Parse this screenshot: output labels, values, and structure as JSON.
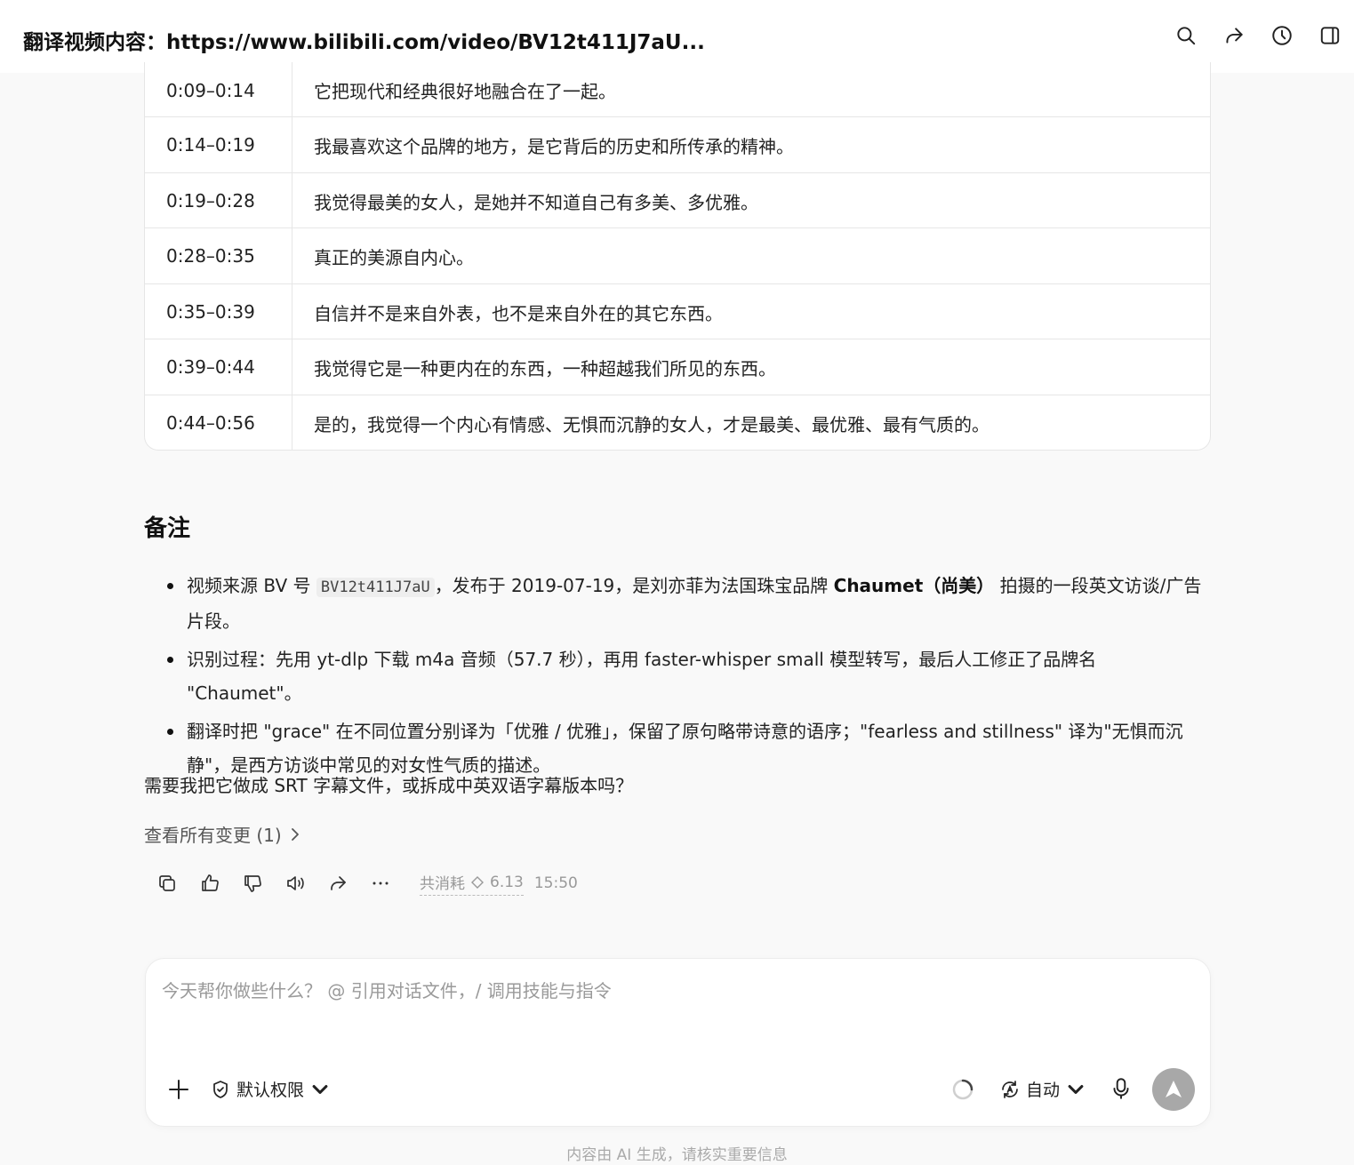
{
  "header": {
    "title": "翻译视频内容：https://www.bilibili.com/video/BV12t411J7aU...",
    "icons": [
      "search-icon",
      "share-icon",
      "history-icon",
      "sidebar-icon"
    ]
  },
  "table": {
    "rows": [
      {
        "time": "0:09–0:14",
        "text": "它把现代和经典很好地融合在了一起。"
      },
      {
        "time": "0:14–0:19",
        "text": "我最喜欢这个品牌的地方，是它背后的历史和所传承的精神。"
      },
      {
        "time": "0:19–0:28",
        "text": "我觉得最美的女人，是她并不知道自己有多美、多优雅。"
      },
      {
        "time": "0:28–0:35",
        "text": "真正的美源自内心。"
      },
      {
        "time": "0:35–0:39",
        "text": "自信并不是来自外表，也不是来自外在的其它东西。"
      },
      {
        "time": "0:39–0:44",
        "text": "我觉得它是一种更内在的东西，一种超越我们所见的东西。"
      },
      {
        "time": "0:44–0:56",
        "text": "是的，我觉得一个内心有情感、无惧而沉静的女人，才是最美、最优雅、最有气质的。"
      }
    ]
  },
  "notes": {
    "heading": "备注",
    "item1": {
      "pre": "视频来源 BV 号 ",
      "code": "BV12t411J7aU",
      "mid": "，发布于 2019-07-19，是刘亦菲为法国珠宝品牌 ",
      "brand": "Chaumet（尚美）",
      "post": " 拍摄的一段英文访谈/广告片段。"
    },
    "item2": "识别过程：先用 yt-dlp 下载 m4a 音频（57.7 秒），再用 faster-whisper small 模型转写，最后人工修正了品牌名 \"Chaumet\"。",
    "item3": "翻译时把 \"grace\" 在不同位置分别译为「优雅 / 优雅」，保留了原句略带诗意的语序；\"fearless and stillness\" 译为\"无惧而沉静\"，是西方访谈中常见的对女性气质的描述。"
  },
  "question": "需要我把它做成 SRT 字幕文件，或拆成中英双语字幕版本吗？",
  "changes_link": "查看所有变更 (1)",
  "actions": {
    "icons": [
      "copy-icon",
      "thumbs-up-icon",
      "thumbs-down-icon",
      "speaker-icon",
      "share-icon",
      "more-icon"
    ],
    "usage_label": "共消耗",
    "usage_value": "6.13",
    "time": "15:50"
  },
  "composer": {
    "placeholder": "今天帮你做些什么？ @ 引用对话文件，/ 调用技能与指令",
    "permission_label": "默认权限",
    "mode_label": "自动"
  },
  "disclaimer": "内容由 AI 生成，请核实重要信息",
  "colors": {
    "background": "#f9f9f9",
    "send_button": "#a8a8a8",
    "muted_text": "#999999"
  }
}
